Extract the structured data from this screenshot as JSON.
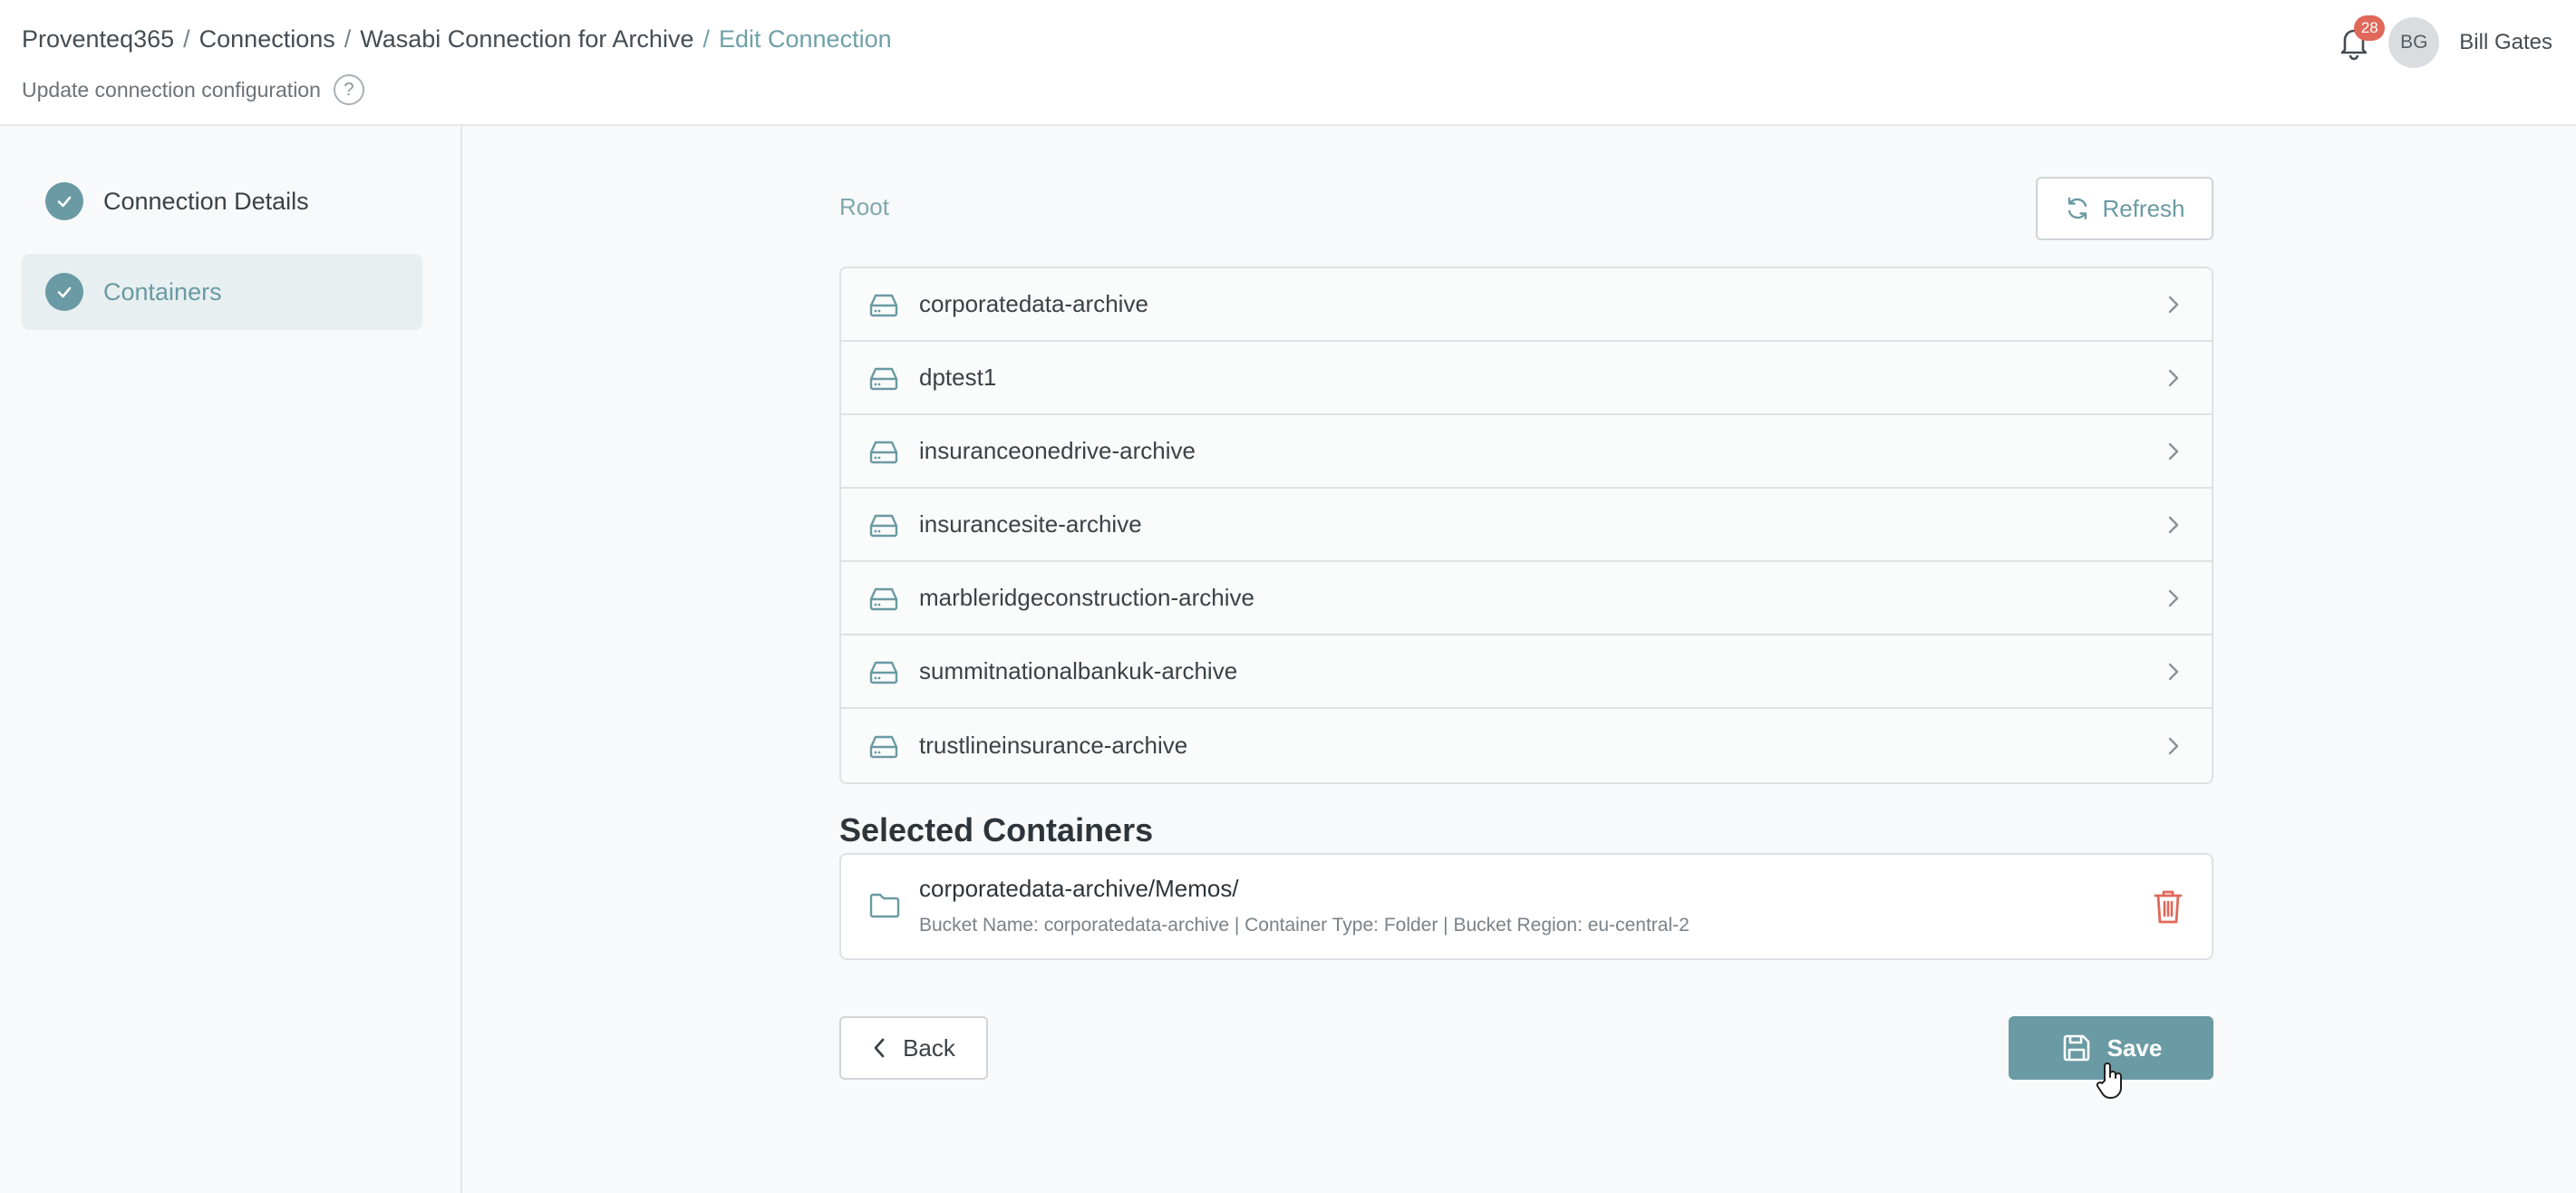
{
  "breadcrumb": {
    "items": [
      "Proventeq365",
      "Connections",
      "Wasabi Connection for Archive"
    ],
    "current": "Edit Connection",
    "separator": "/"
  },
  "subtitle": "Update connection configuration",
  "help_icon": {
    "icon": "question-circle-icon",
    "glyph": "?"
  },
  "notifications": {
    "icon": "bell-icon",
    "count": "28"
  },
  "user": {
    "initials": "BG",
    "name": "Bill Gates"
  },
  "steps": [
    {
      "label": "Connection Details",
      "status": "complete"
    },
    {
      "label": "Containers",
      "status": "complete",
      "active": true
    }
  ],
  "browser": {
    "root_label": "Root",
    "refresh_label": "Refresh",
    "items": [
      "corporatedata-archive",
      "dptest1",
      "insuranceonedrive-archive",
      "insurancesite-archive",
      "marbleridgeconstruction-archive",
      "summitnationalbankuk-archive",
      "trustlineinsurance-archive"
    ]
  },
  "selected": {
    "heading": "Selected Containers",
    "items": [
      {
        "path": "corporatedata-archive/Memos/",
        "details": "Bucket Name: corporatedata-archive | Container Type: Folder | Bucket Region: eu-central-2"
      }
    ]
  },
  "actions": {
    "back_label": "Back",
    "save_label": "Save"
  },
  "colors": {
    "accent": "#6a9aa3",
    "danger": "#e0685a",
    "badge": "#e0685a"
  }
}
